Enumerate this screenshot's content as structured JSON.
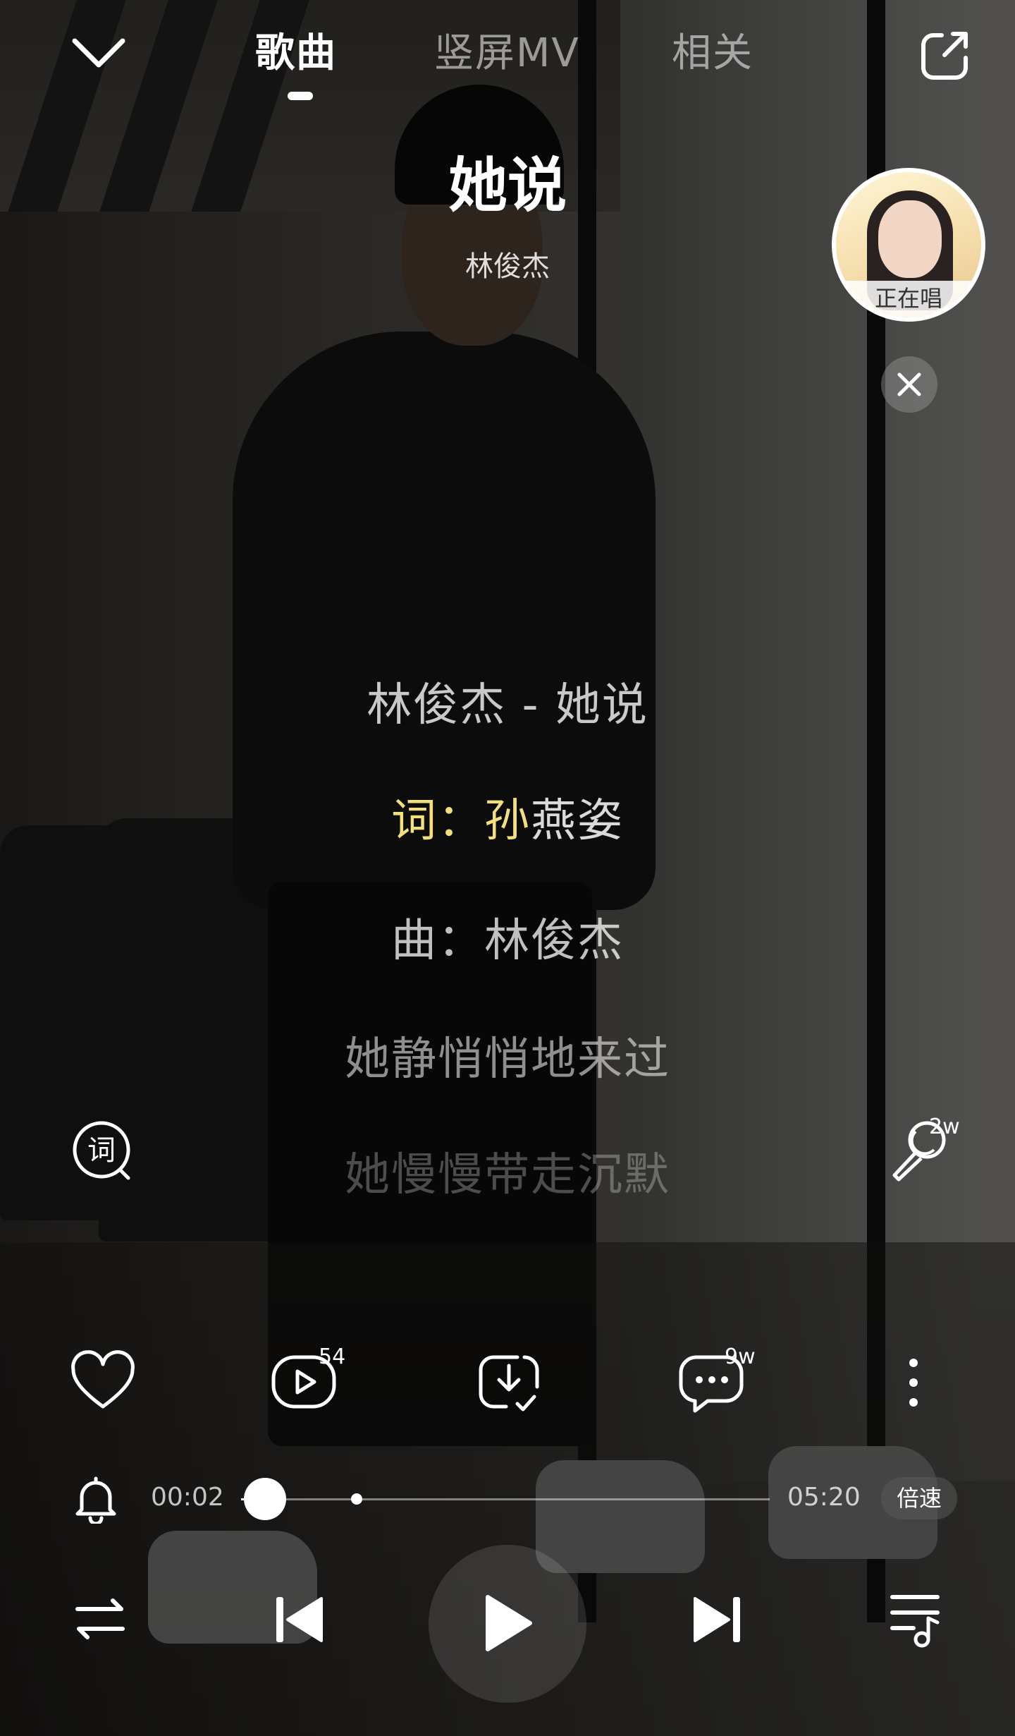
{
  "nav": {
    "tabs": [
      {
        "label": "歌曲",
        "active": true
      },
      {
        "label": "竖屏MV",
        "active": false
      },
      {
        "label": "相关",
        "active": false
      }
    ]
  },
  "song": {
    "title": "她说",
    "artist": "林俊杰"
  },
  "singing_now": {
    "label": "正在唱"
  },
  "lyrics": {
    "line1": "林俊杰 - 她说",
    "line2_highlight": "词：孙",
    "line2_rest": "燕姿",
    "line3": "曲：林俊杰",
    "line4": "她静悄悄地来过",
    "line5": "她慢慢带走沉默"
  },
  "mic_count": "2w",
  "actions": {
    "mv_count": "54",
    "comment_count": "9w"
  },
  "progress": {
    "current": "00:02",
    "total": "05:20",
    "fraction": 0.006
  },
  "speed_label": "倍速",
  "icons": [
    "chevron-down-icon",
    "share-icon",
    "close-icon",
    "lyrics-icon",
    "mic-icon",
    "heart-icon",
    "mv-play-icon",
    "download-icon",
    "comment-icon",
    "more-icon",
    "bell-icon",
    "shuffle-icon",
    "previous-icon",
    "play-icon",
    "next-icon",
    "playlist-icon"
  ]
}
